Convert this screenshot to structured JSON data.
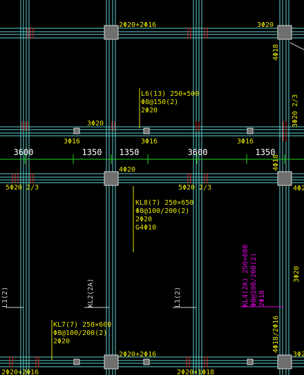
{
  "colors": {
    "background": "#000000",
    "beam_line": "#5fd3d3",
    "beam_line_inner": "#3aa0a8",
    "column_fill": "#6f6f6f",
    "column_edge": "#d8d8d8",
    "annotation_yellow": "#e6e600",
    "annotation_magenta": "#e000e0",
    "dimension_green": "#27d427",
    "dimension_text": "#ffffff",
    "rebar_tick": "#e02020"
  },
  "top_beam": {
    "left_label": "2Φ20+2Φ16",
    "right_label": "3Φ20"
  },
  "right_edge": {
    "top_label": "4Φ18",
    "mid_label_a": "3Φ20 2/3",
    "mid_label_b": "3Φ20",
    "lower_label": "4Φ18",
    "bottom_right_label": "3Φ20",
    "right_row_label": "4Φ2"
  },
  "beam_L6": {
    "name": "L6(13) 250×500",
    "stirrup": "Φ8@150(2)",
    "top": "2Φ20",
    "bottom_left": "3Φ20"
  },
  "mid_labels": {
    "a": "3Φ16",
    "b": "3Φ16",
    "c": "3Φ16"
  },
  "dimensions": [
    "3600",
    "1350",
    "1350",
    "3600",
    "1350"
  ],
  "row_labels": {
    "left": "5Φ20 2/3",
    "center": "5Φ20 2/3",
    "col_top": "4Φ20"
  },
  "beam_KL8": {
    "name": "KL8(7) 250×650",
    "stirrup": "Φ8@100/200(2)",
    "top": "2Φ20",
    "side": "G4Φ10"
  },
  "beam_KL4": {
    "name": "KL4(2A) 250×600",
    "stirrup": "Φ8@100/200(2)",
    "top": "2Φ18"
  },
  "vertical_labels": {
    "l1": "L1(2)",
    "kl2": "KL2(2A)",
    "l1b": "L1(2)",
    "kl_right": "4Φ18/2Φ16"
  },
  "beam_KL7": {
    "name": "KL7(7) 250×600",
    "stirrup": "Φ8@100/200(2)",
    "top": "2Φ20"
  },
  "bottom_labels": {
    "left": "2Φ20+2Φ16",
    "center_top": "2Φ20+2Φ16",
    "center_bottom": "2Φ20+1Φ18",
    "right": "3Φ2"
  }
}
